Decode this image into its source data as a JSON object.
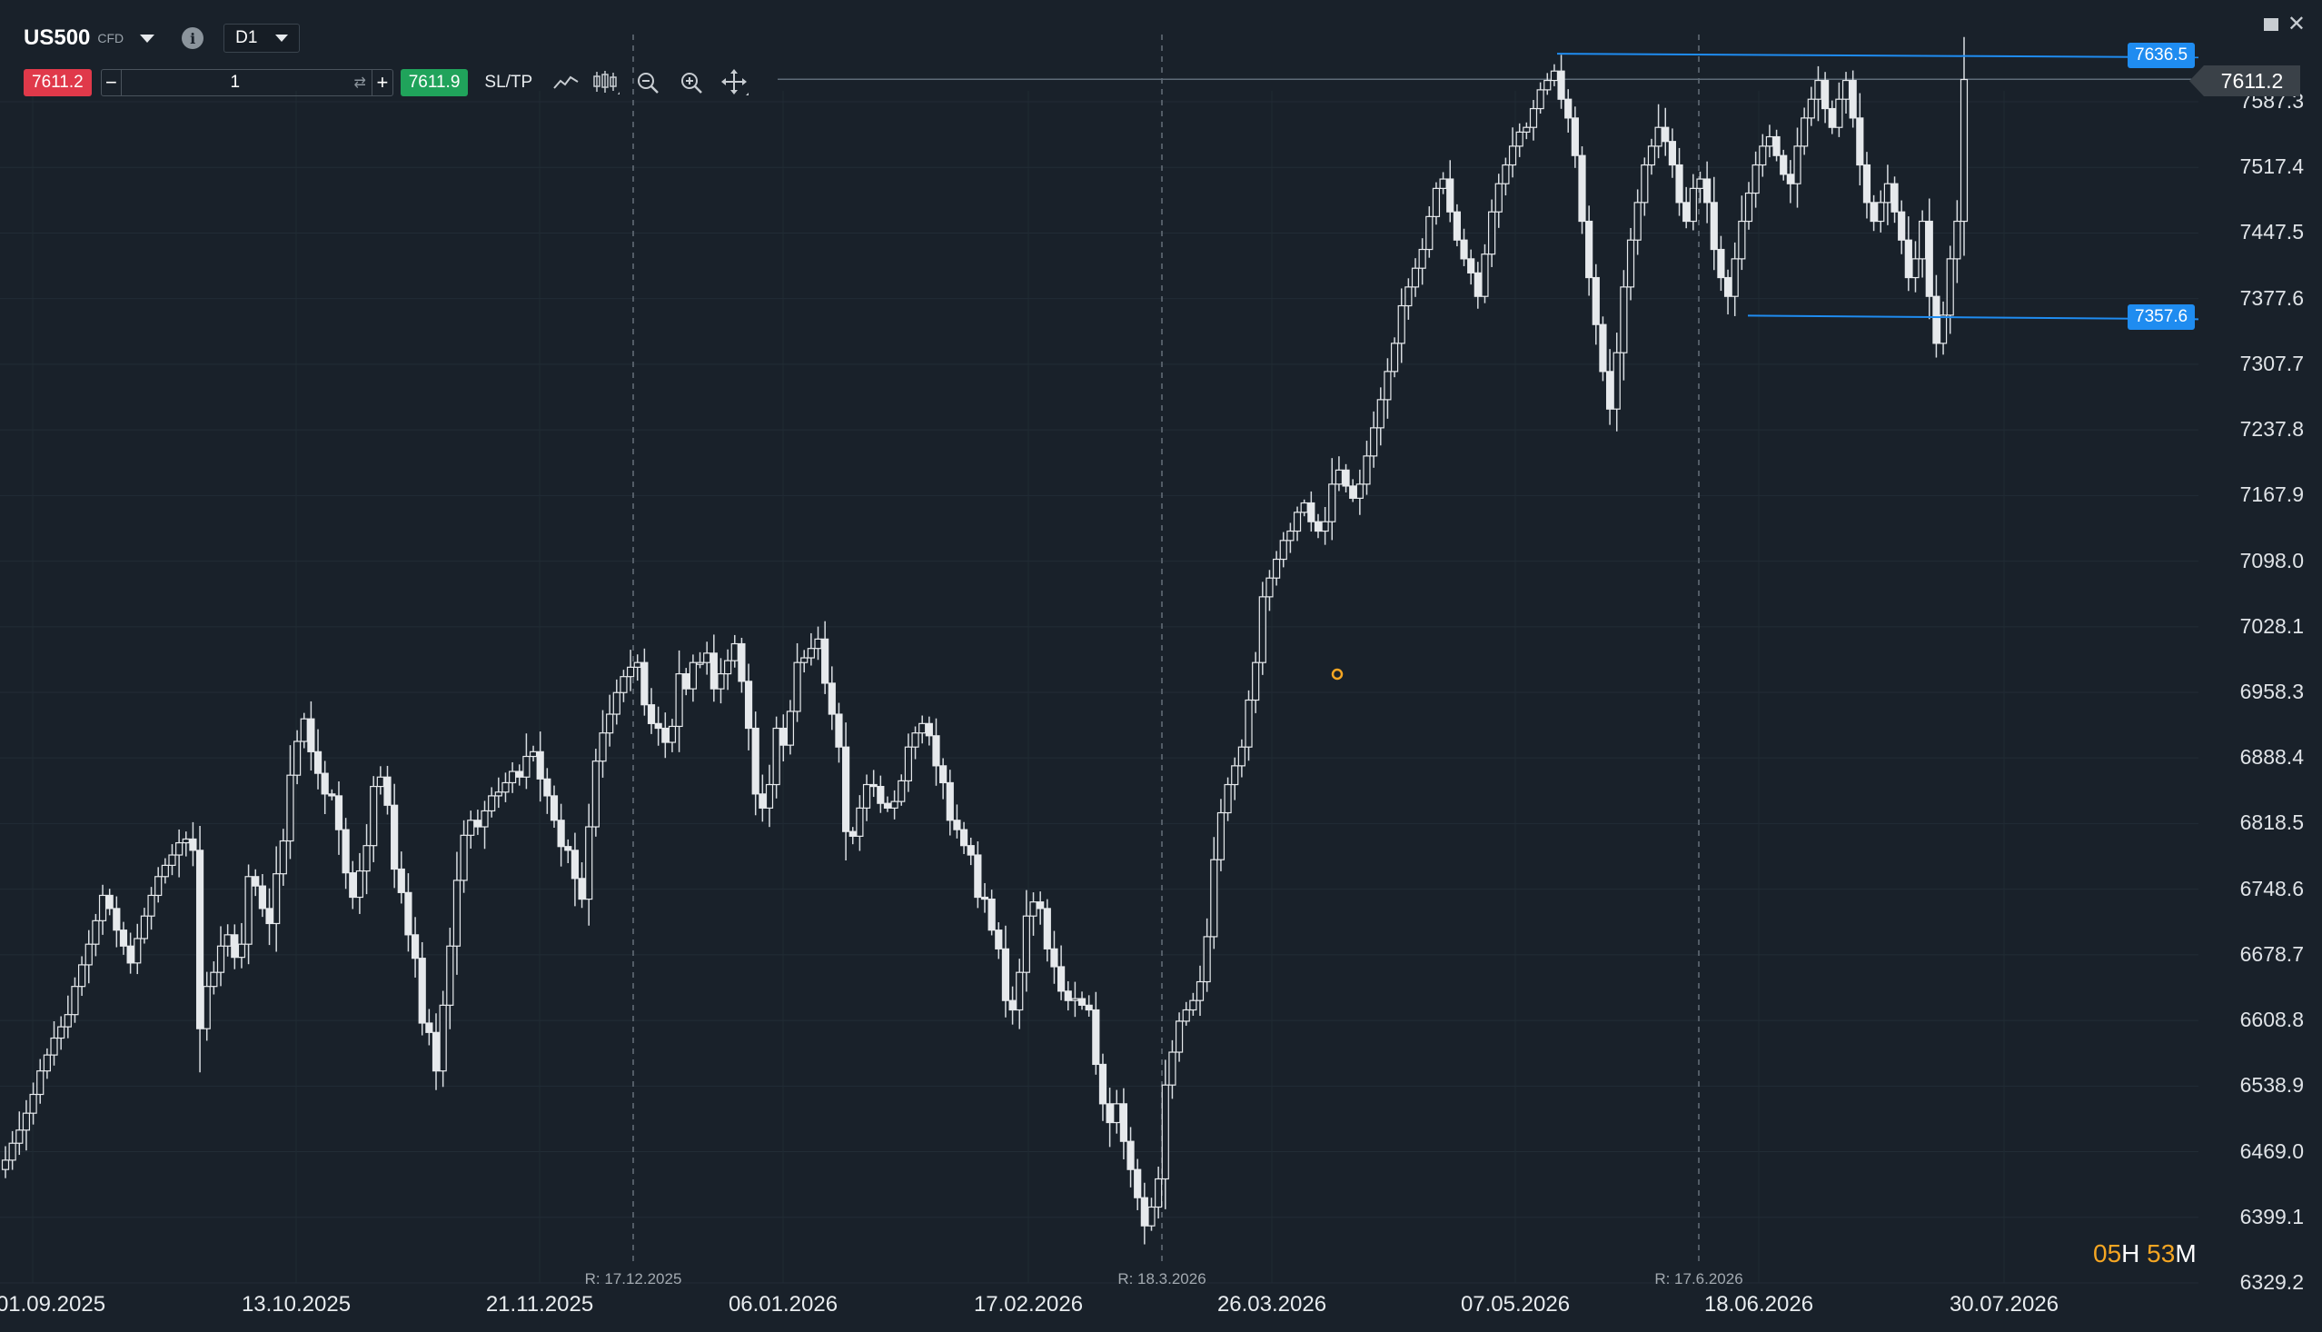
{
  "header": {
    "symbol": "US500",
    "instrument_type": "CFD",
    "timeframe": "D1"
  },
  "order_bar": {
    "sell_price": "7611.2",
    "quantity": "1",
    "buy_price": "7611.9",
    "sltp_label": "SL/TP"
  },
  "icons": [
    "line-chart-icon",
    "candlestick-icon",
    "zoom-out-icon",
    "zoom-in-icon",
    "crosshair-move-icon",
    "info-icon",
    "minimize-icon",
    "close-icon"
  ],
  "colors": {
    "background": "#19212a",
    "sell": "#e0394a",
    "buy": "#20a35b",
    "drawing_line": "#1f8cf0",
    "countdown": "#f5a623"
  },
  "chart_data": {
    "type": "candlestick",
    "y_axis": {
      "ticks": [
        "7587.3",
        "7517.4",
        "7447.5",
        "7377.6",
        "7307.7",
        "7237.8",
        "7167.9",
        "7098.0",
        "7028.1",
        "6958.3",
        "6888.4",
        "6818.5",
        "6748.6",
        "6678.7",
        "6608.8",
        "6538.9",
        "6469.0",
        "6399.1",
        "6329.2"
      ],
      "ylim": [
        6329.2,
        7636.5
      ]
    },
    "x_axis": {
      "ticks": [
        "01.09.2025",
        "13.10.2025",
        "21.11.2025",
        "06.01.2026",
        "17.02.2026",
        "26.03.2026",
        "07.05.2026",
        "18.06.2026",
        "30.07.2026"
      ]
    },
    "rollovers": [
      "R: 17.12.2025",
      "R: 18.3.2026",
      "R: 17.6.2026"
    ],
    "current_price": "7611.2",
    "horizontal_lines": [
      {
        "label": "7636.5",
        "value": 7636.5
      },
      {
        "label": "7357.6",
        "value": 7357.6
      }
    ],
    "countdown": {
      "hours": "05",
      "hours_unit": "H",
      "minutes": "53",
      "minutes_unit": "M"
    },
    "closes": [
      6460,
      6478,
      6492,
      6510,
      6530,
      6555,
      6572,
      6590,
      6602,
      6615,
      6645,
      6668,
      6690,
      6715,
      6742,
      6728,
      6705,
      6688,
      6670,
      6696,
      6720,
      6742,
      6762,
      6774,
      6785,
      6798,
      6802,
      6790,
      6600,
      6645,
      6660,
      6688,
      6700,
      6676,
      6690,
      6762,
      6752,
      6728,
      6712,
      6765,
      6800,
      6870,
      6906,
      6930,
      6895,
      6872,
      6850,
      6848,
      6812,
      6766,
      6740,
      6768,
      6795,
      6858,
      6868,
      6838,
      6770,
      6745,
      6700,
      6675,
      6606,
      6596,
      6555,
      6625,
      6688,
      6758,
      6806,
      6822,
      6815,
      6832,
      6848,
      6852,
      6862,
      6874,
      6868,
      6890,
      6895,
      6866,
      6848,
      6822,
      6794,
      6790,
      6760,
      6738,
      6815,
      6885,
      6915,
      6935,
      6958,
      6975,
      6985,
      6990,
      6945,
      6925,
      6920,
      6905,
      6922,
      6978,
      6962,
      6990,
      6990,
      7000,
      6962,
      6978,
      6992,
      7010,
      6970,
      6920,
      6850,
      6835,
      6860,
      6920,
      6902,
      6938,
      6990,
      6995,
      7005,
      7015,
      6968,
      6935,
      6900,
      6810,
      6805,
      6835,
      6860,
      6858,
      6840,
      6835,
      6842,
      6864,
      6900,
      6915,
      6925,
      6912,
      6880,
      6862,
      6822,
      6812,
      6795,
      6785,
      6740,
      6738,
      6705,
      6685,
      6630,
      6620,
      6660,
      6720,
      6735,
      6728,
      6685,
      6666,
      6640,
      6630,
      6632,
      6625,
      6620,
      6562,
      6520,
      6500,
      6520,
      6480,
      6450,
      6420,
      6390,
      6410,
      6440,
      6540,
      6575,
      6608,
      6620,
      6630,
      6650,
      6698,
      6780,
      6830,
      6860,
      6880,
      6900,
      6950,
      6990,
      7060,
      7080,
      7100,
      7120,
      7130,
      7150,
      7160,
      7140,
      7130,
      7140,
      7180,
      7195,
      7178,
      7165,
      7180,
      7210,
      7240,
      7270,
      7300,
      7330,
      7370,
      7390,
      7410,
      7430,
      7465,
      7495,
      7505,
      7470,
      7440,
      7420,
      7405,
      7380,
      7425,
      7470,
      7500,
      7520,
      7540,
      7555,
      7560,
      7580,
      7600,
      7610,
      7620,
      7590,
      7570,
      7530,
      7460,
      7400,
      7350,
      7300,
      7260,
      7320,
      7390,
      7440,
      7480,
      7520,
      7540,
      7560,
      7545,
      7520,
      7480,
      7460,
      7495,
      7505,
      7480,
      7430,
      7400,
      7380,
      7420,
      7460,
      7490,
      7520,
      7540,
      7550,
      7530,
      7510,
      7500,
      7540,
      7570,
      7590,
      7610,
      7580,
      7560,
      7590,
      7610,
      7570,
      7520,
      7480,
      7460,
      7480,
      7500,
      7470,
      7440,
      7400,
      7420,
      7460,
      7380,
      7330,
      7360,
      7420,
      7460,
      7611
    ]
  }
}
